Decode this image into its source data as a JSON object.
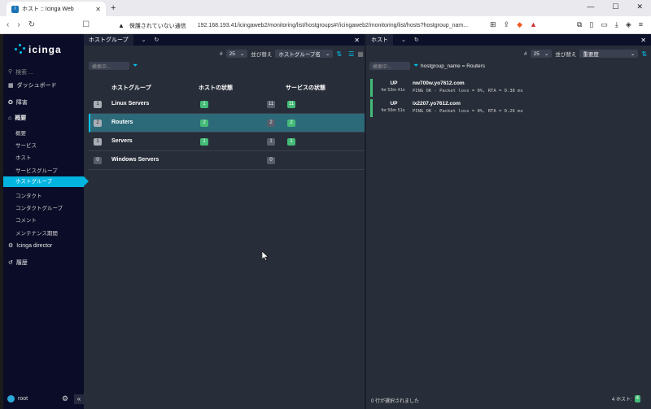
{
  "browser": {
    "tab_title": "ホスト :: Icinga Web",
    "security_text": "保護されていない通信",
    "url": "192.168.193.41/icingaweb2/monitoring/list/hostgroups#!/icingaweb2/monitoring/list/hosts?hostgroup_nam..."
  },
  "sidebar": {
    "logo_text": "icinga",
    "search_placeholder": "検索 ...",
    "items": [
      {
        "label": "ダッシュボード",
        "icon": "dashboard-icon"
      },
      {
        "label": "障害",
        "icon": "problems-icon"
      },
      {
        "label": "概要",
        "icon": "overview-icon"
      }
    ],
    "sub_items": [
      "概要",
      "サービス",
      "ホスト",
      "サービスグループ",
      "ホストグループ",
      "コンタクト",
      "コンタクトグループ",
      "コメント",
      "メンテナンス期間"
    ],
    "director": "Icinga director",
    "history": "履歴",
    "user": "root"
  },
  "left_column": {
    "tab_label": "ホストグループ",
    "limit_label": "#",
    "limit_value": "25",
    "sort_label": "並び替え",
    "sort_value": "ホストグループ名",
    "search_placeholder": "検索中...",
    "headers": [
      "ホストグループ",
      "ホストの状態",
      "サービスの状態"
    ],
    "rows": [
      {
        "count": "1",
        "name": "Linux Servers",
        "host_up": "1",
        "svc_total": "11",
        "svc_ok": "11",
        "svc_ok_present": true
      },
      {
        "count": "2",
        "name": "Routers",
        "host_up": "2",
        "svc_total": "2",
        "svc_ok": "2",
        "svc_ok_present": true
      },
      {
        "count": "1",
        "name": "Servers",
        "host_up": "1",
        "svc_total": "1",
        "svc_ok": "1",
        "svc_ok_present": true
      },
      {
        "count": "0",
        "name": "Windows Servers",
        "host_up": "",
        "svc_total": "0",
        "svc_ok": "",
        "svc_ok_present": false
      }
    ]
  },
  "right_column": {
    "tab_label": "ホスト",
    "limit_label": "#",
    "limit_value": "25",
    "sort_label": "並び替え",
    "sort_value": "重要度",
    "search_placeholder": "検索中...",
    "filter_text": "hostgroup_name = Routers",
    "hosts": [
      {
        "state": "UP",
        "since": "for 53m 41s",
        "name": "nw700w.yo7612.com",
        "output": "PING OK - Packet loss = 0%, RTA = 0.38 ms"
      },
      {
        "state": "UP",
        "since": "for 56m 51s",
        "name": "ix2207.yo7612.com",
        "output": "PING OK - Packet loss = 0%, RTA = 0.26 ms"
      }
    ],
    "selected_text": "0 行が選択されました",
    "host_count_label": "4 ホスト:",
    "host_count": "4"
  },
  "colors": {
    "accent": "#00c3ed",
    "ok": "#44bb77",
    "sidebar_bg": "#0b0d28",
    "main_bg": "#282e39"
  }
}
